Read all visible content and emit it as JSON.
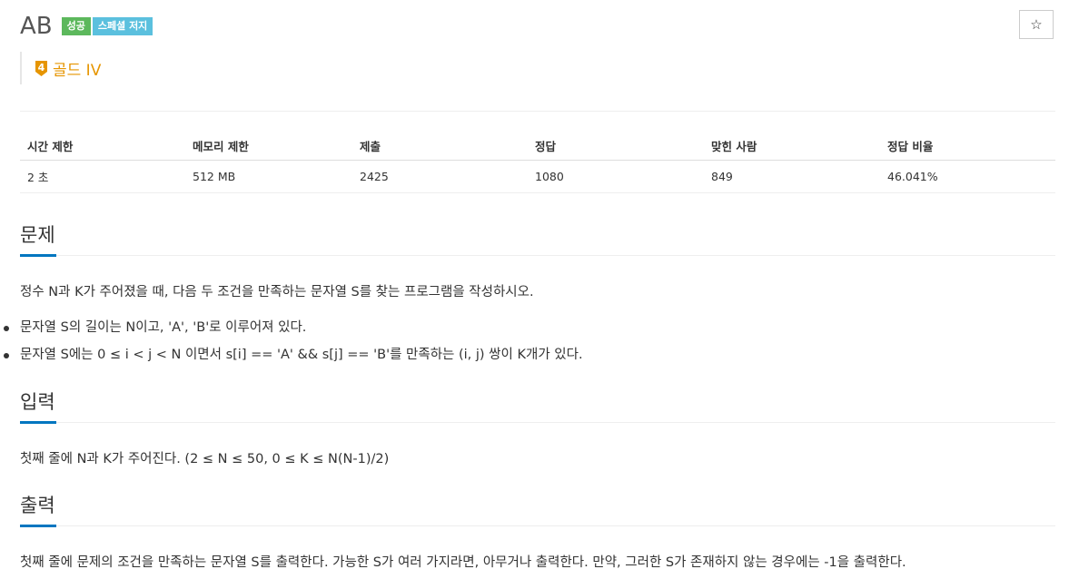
{
  "problem": {
    "title": "AB",
    "badges": {
      "success": "성공",
      "special": "스페셜 저지"
    },
    "tier": {
      "level": "4",
      "label": "골드 IV"
    },
    "star_icon": "star-outline-icon"
  },
  "info_table": {
    "headers": [
      "시간 제한",
      "메모리 제한",
      "제출",
      "정답",
      "맞힌 사람",
      "정답 비율"
    ],
    "values": [
      "2 초",
      "512 MB",
      "2425",
      "1080",
      "849",
      "46.041%"
    ]
  },
  "sections": {
    "description": {
      "title": "문제",
      "text": "정수 N과 K가 주어졌을 때, 다음 두 조건을 만족하는 문자열 S를 찾는 프로그램을 작성하시오.",
      "bullets": [
        "문자열 S의 길이는 N이고, 'A', 'B'로 이루어져 있다.",
        "문자열 S에는 0 ≤ i < j < N 이면서 s[i] == 'A' && s[j] == 'B'를 만족하는 (i, j) 쌍이 K개가 있다."
      ]
    },
    "input": {
      "title": "입력",
      "text": "첫째 줄에 N과 K가 주어진다. (2 ≤ N ≤ 50, 0 ≤ K ≤ N(N-1)/2)"
    },
    "output": {
      "title": "출력",
      "text": "첫째 줄에 문제의 조건을 만족하는 문자열 S를 출력한다. 가능한 S가 여러 가지라면, 아무거나 출력한다. 만약, 그러한 S가 존재하지 않는 경우에는 -1을 출력한다."
    }
  },
  "colors": {
    "tier_gold": "#e69500",
    "accent": "#0076c0",
    "success": "#5cb85c",
    "special": "#5bc0de"
  }
}
